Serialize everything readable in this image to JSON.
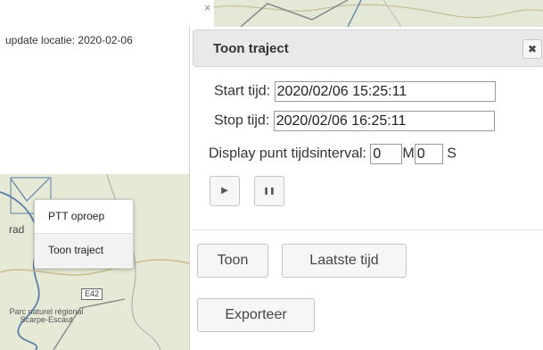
{
  "info_popup": {
    "text": "update locatie: 2020-02-06",
    "close_glyph": "×"
  },
  "context_menu": {
    "items": [
      {
        "label": "PTT oproep"
      },
      {
        "label": "Toon traject"
      }
    ]
  },
  "map": {
    "road_label": "E42",
    "park_label": "Parc naturel régional Scarpe-Escaut",
    "place_label": "rad"
  },
  "dialog": {
    "title": "Toon traject",
    "close_glyph": "✖",
    "start_label": "Start tijd:",
    "start_value": "2020/02/06 15:25:11",
    "stop_label": "Stop tijd:",
    "stop_value": "2020/02/06 16:25:11",
    "interval_label": "Display punt tijdsinterval:",
    "interval_minutes": "0",
    "minutes_unit": "M",
    "interval_seconds": "0",
    "seconds_unit": "S",
    "play_glyph": "▶",
    "pause_glyph": "❚❚",
    "toon_button": "Toon",
    "latest_button": "Laatste tijd",
    "export_button": "Exporteer"
  },
  "colors": {
    "header_bg": "#e9e9e9",
    "button_bg": "#f6f6f6",
    "map_land": "#e6e9d6",
    "map_river": "#5b7fa8"
  }
}
